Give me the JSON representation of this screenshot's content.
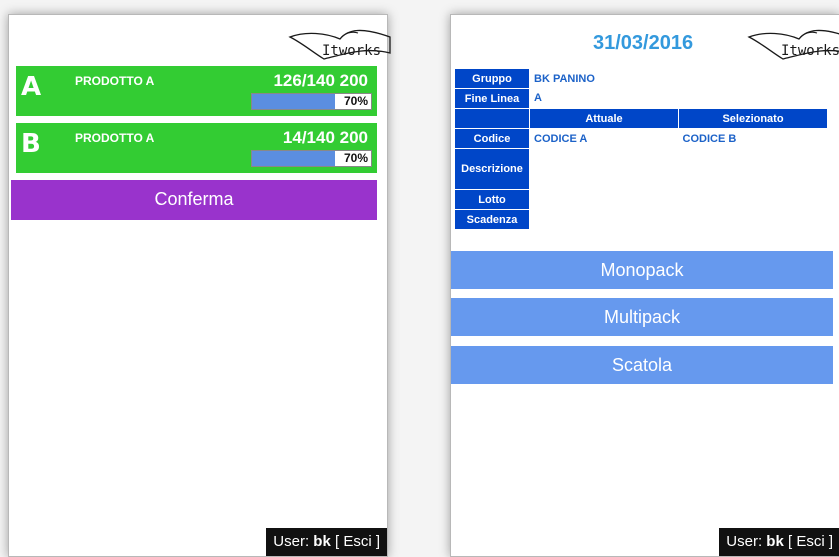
{
  "left": {
    "logo_text": "Itworks",
    "products": [
      {
        "letter": "A",
        "name": "PRODOTTO A",
        "count": "126/140 200",
        "progress_label": "70%",
        "progress": 0.7
      },
      {
        "letter": "B",
        "name": "PRODOTTO A",
        "count": "14/140 200",
        "progress_label": "70%",
        "progress": 0.7
      }
    ],
    "confirm_label": "Conferma",
    "user_prefix": "User:",
    "user_name": "bk",
    "logout_label": "[ Esci ]"
  },
  "right": {
    "date": "31/03/2016",
    "logo_text": "Itworks",
    "table": {
      "gruppo_label": "Gruppo",
      "gruppo_value": "BK PANINO",
      "fine_linea_label": "Fine Linea",
      "fine_linea_value": "A",
      "col_attuale": "Attuale",
      "col_selezionato": "Selezionato",
      "codice_label": "Codice",
      "codice_attuale": "CODICE A",
      "codice_selezionato": "CODICE B",
      "descrizione_label": "Descrizione",
      "lotto_label": "Lotto",
      "scadenza_label": "Scadenza"
    },
    "buttons": {
      "monopack": "Monopack",
      "multipack": "Multipack",
      "scatola": "Scatola"
    },
    "user_prefix": "User:",
    "user_name": "bk",
    "logout_label": "[ Esci ]"
  },
  "colors": {
    "card_green": "#33cc33",
    "confirm_purple": "#9933cc",
    "table_blue": "#0046c8",
    "action_blue": "#6699ee",
    "date_blue": "#3399dd"
  }
}
